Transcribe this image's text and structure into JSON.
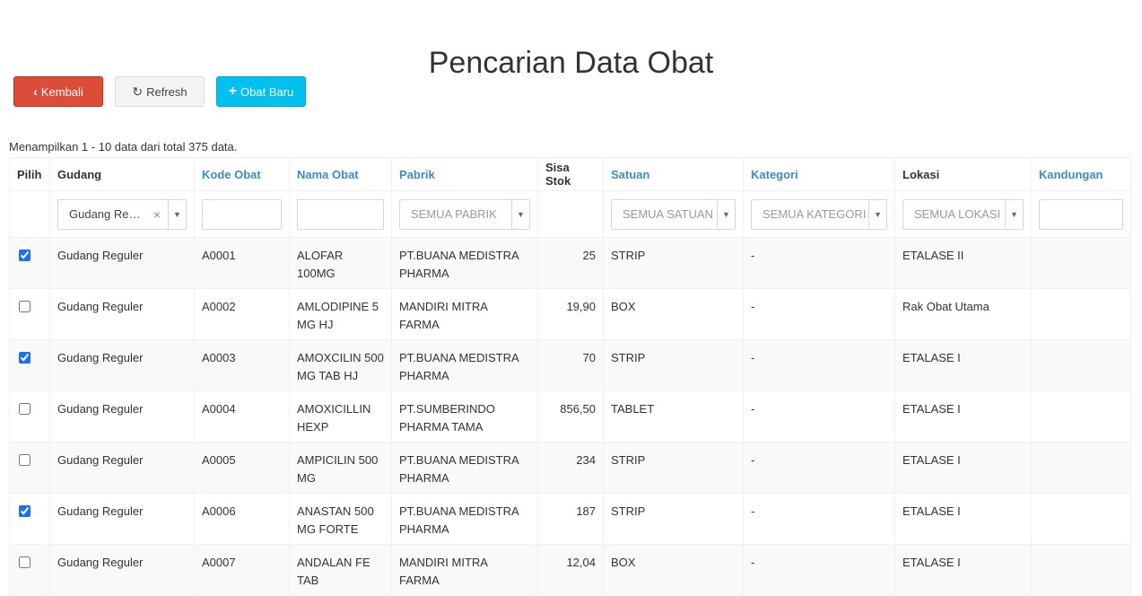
{
  "page_title": "Pencarian Data Obat",
  "toolbar": {
    "back_label": "Kembali",
    "refresh_label": "Refresh",
    "new_label": "Obat Baru"
  },
  "summary": "Menampilkan 1 - 10 data dari total 375 data.",
  "columns": {
    "pilih": "Pilih",
    "gudang": "Gudang",
    "kode": "Kode Obat",
    "nama": "Nama Obat",
    "pabrik": "Pabrik",
    "stok": "Sisa Stok",
    "satuan": "Satuan",
    "kategori": "Kategori",
    "lokasi": "Lokasi",
    "kandungan": "Kandungan"
  },
  "filters": {
    "gudang_value": "Gudang Re…",
    "pabrik_placeholder": "SEMUA PABRIK",
    "satuan_placeholder": "SEMUA SATUAN",
    "kategori_placeholder": "SEMUA KATEGORI",
    "lokasi_placeholder": "SEMUA LOKASI"
  },
  "rows": [
    {
      "checked": true,
      "gudang": "Gudang Reguler",
      "kode": "A0001",
      "nama": "ALOFAR 100MG",
      "pabrik": "PT.BUANA MEDISTRA PHARMA",
      "stok": "25",
      "satuan": "STRIP",
      "kategori": "-",
      "lokasi": "ETALASE II",
      "kandungan": ""
    },
    {
      "checked": false,
      "gudang": "Gudang Reguler",
      "kode": "A0002",
      "nama": "AMLODIPINE 5 MG HJ",
      "pabrik": "MANDIRI MITRA FARMA",
      "stok": "19,90",
      "satuan": "BOX",
      "kategori": "-",
      "lokasi": "Rak Obat Utama",
      "kandungan": ""
    },
    {
      "checked": true,
      "gudang": "Gudang Reguler",
      "kode": "A0003",
      "nama": "AMOXCILIN 500 MG TAB HJ",
      "pabrik": "PT.BUANA MEDISTRA PHARMA",
      "stok": "70",
      "satuan": "STRIP",
      "kategori": "-",
      "lokasi": "ETALASE I",
      "kandungan": ""
    },
    {
      "checked": false,
      "gudang": "Gudang Reguler",
      "kode": "A0004",
      "nama": "AMOXICILLIN HEXP",
      "pabrik": "PT.SUMBERINDO PHARMA TAMA",
      "stok": "856,50",
      "satuan": "TABLET",
      "kategori": "-",
      "lokasi": "ETALASE I",
      "kandungan": ""
    },
    {
      "checked": false,
      "gudang": "Gudang Reguler",
      "kode": "A0005",
      "nama": "AMPICILIN 500 MG",
      "pabrik": "PT.BUANA MEDISTRA PHARMA",
      "stok": "234",
      "satuan": "STRIP",
      "kategori": "-",
      "lokasi": "ETALASE I",
      "kandungan": ""
    },
    {
      "checked": true,
      "gudang": "Gudang Reguler",
      "kode": "A0006",
      "nama": "ANASTAN 500 MG FORTE",
      "pabrik": "PT.BUANA MEDISTRA PHARMA",
      "stok": "187",
      "satuan": "STRIP",
      "kategori": "-",
      "lokasi": "ETALASE I",
      "kandungan": ""
    },
    {
      "checked": false,
      "gudang": "Gudang Reguler",
      "kode": "A0007",
      "nama": "ANDALAN FE TAB",
      "pabrik": "MANDIRI MITRA FARMA",
      "stok": "12,04",
      "satuan": "BOX",
      "kategori": "-",
      "lokasi": "ETALASE I",
      "kandungan": ""
    }
  ]
}
